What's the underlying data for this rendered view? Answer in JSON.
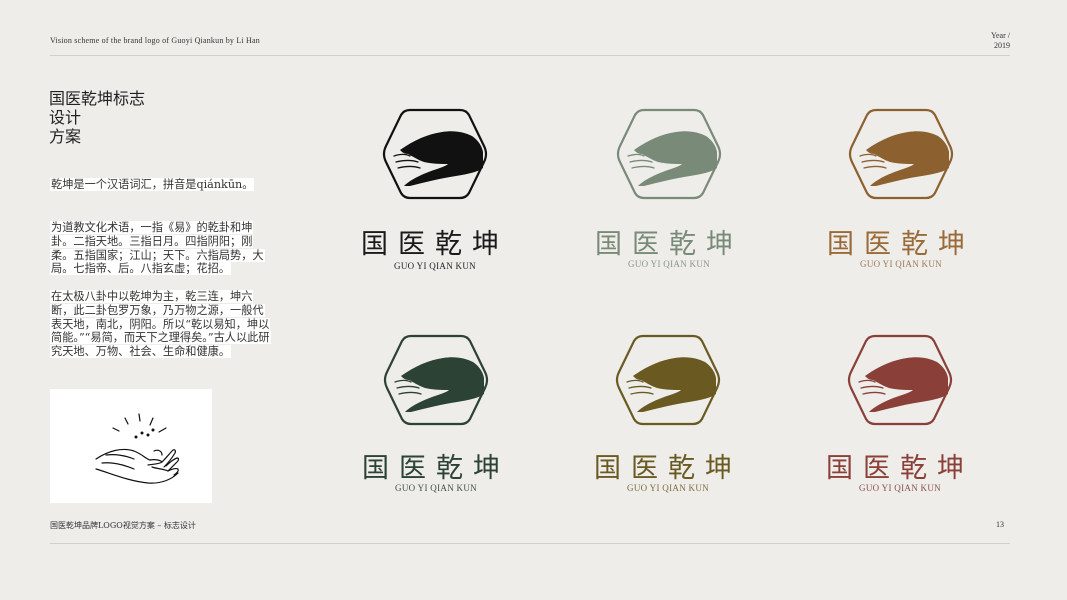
{
  "header": {
    "left_text": "Vision scheme of the brand logo of Guoyi Qiankun by Li Han",
    "year_label": "Year /",
    "year_value": "2019"
  },
  "title": {
    "line1": "国医乾坤标志",
    "line2": "设计",
    "line3": "方案"
  },
  "body": {
    "para1": "乾坤是一个汉语词汇，拼音是qiánkūn。",
    "para2": "为道教文化术语，一指《易》的乾卦和坤卦。二指天地。三指日月。四指阴阳；刚柔。五指国家；江山；天下。六指局势，大局。七指帝、后。八指玄虚；花招。",
    "para3": "在太极八卦中以乾坤为主，乾三连，坤六断，此二卦包罗万象，乃万物之源，一般代表天地，南北，阴阳。所以“乾以易知，坤以简能。”“易简，而天下之理得矣。”古人以此研究天地、万物、社会、生命和健康。"
  },
  "logos": [
    {
      "name_cn": "国医乾坤",
      "name_en": "GUO YI QIAN KUN",
      "color": "#111111",
      "text_color": "#1a1a1a",
      "en_color": "#222222"
    },
    {
      "name_cn": "国医乾坤",
      "name_en": "GUO YI QIAN KUN",
      "color": "#7a8a78",
      "text_color": "#7a8a78",
      "en_color": "#8a958a"
    },
    {
      "name_cn": "国医乾坤",
      "name_en": "GUO YI QIAN KUN",
      "color": "#8d6030",
      "text_color": "#9a6a38",
      "en_color": "#9a7a58"
    },
    {
      "name_cn": "国医乾坤",
      "name_en": "GUO YI QIAN KUN",
      "color": "#2b4234",
      "text_color": "#2b4234",
      "en_color": "#3c5244"
    },
    {
      "name_cn": "国医乾坤",
      "name_en": "GUO YI QIAN KUN",
      "color": "#6a5a22",
      "text_color": "#6a5a22",
      "en_color": "#7a6c3c"
    },
    {
      "name_cn": "国医乾坤",
      "name_en": "GUO YI QIAN KUN",
      "color": "#8a4038",
      "text_color": "#8a4038",
      "en_color": "#8a5048"
    }
  ],
  "footer": {
    "left_text": "国医乾坤品牌LOGO视觉方案 – 标志设计",
    "page_number": "13"
  }
}
